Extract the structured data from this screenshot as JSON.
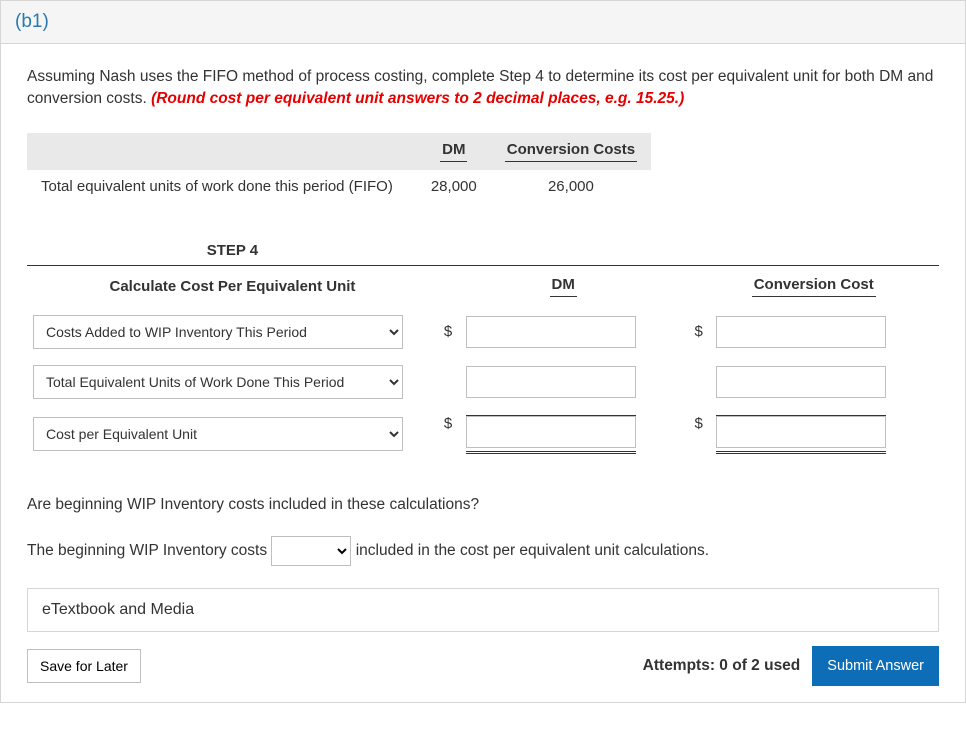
{
  "header": {
    "part_label": "(b1)"
  },
  "instructions": {
    "text_a": "Assuming Nash uses the FIFO method of process costing, complete Step 4 to determine its cost per equivalent unit for both DM and conversion costs. ",
    "hint": "(Round cost per equivalent unit answers to 2 decimal places, e.g. 15.25.)"
  },
  "eq_table": {
    "col_dm": "DM",
    "col_cc": "Conversion Costs",
    "row_label": "Total equivalent units of work done this period (FIFO)",
    "dm_val": "28,000",
    "cc_val": "26,000"
  },
  "step4": {
    "title": "STEP 4",
    "col_calc": "Calculate Cost Per Equivalent Unit",
    "col_dm": "DM",
    "col_cc": "Conversion Cost",
    "rows": [
      {
        "select": "Costs Added to WIP Inventory This Period",
        "show_dollar": true
      },
      {
        "select": "Total Equivalent Units of Work Done This Period",
        "show_dollar": false
      },
      {
        "select": "Cost per Equivalent Unit",
        "show_dollar": true,
        "double_rule": true
      }
    ],
    "dollar": "$"
  },
  "question2": "Are beginning WIP Inventory costs included in these calculations?",
  "sentence": {
    "pre": "The beginning WIP Inventory costs ",
    "post": " included in the cost per equivalent unit calculations."
  },
  "etm": "eTextbook and Media",
  "footer": {
    "save": "Save for Later",
    "attempts": "Attempts: 0 of 2 used",
    "submit": "Submit Answer"
  }
}
